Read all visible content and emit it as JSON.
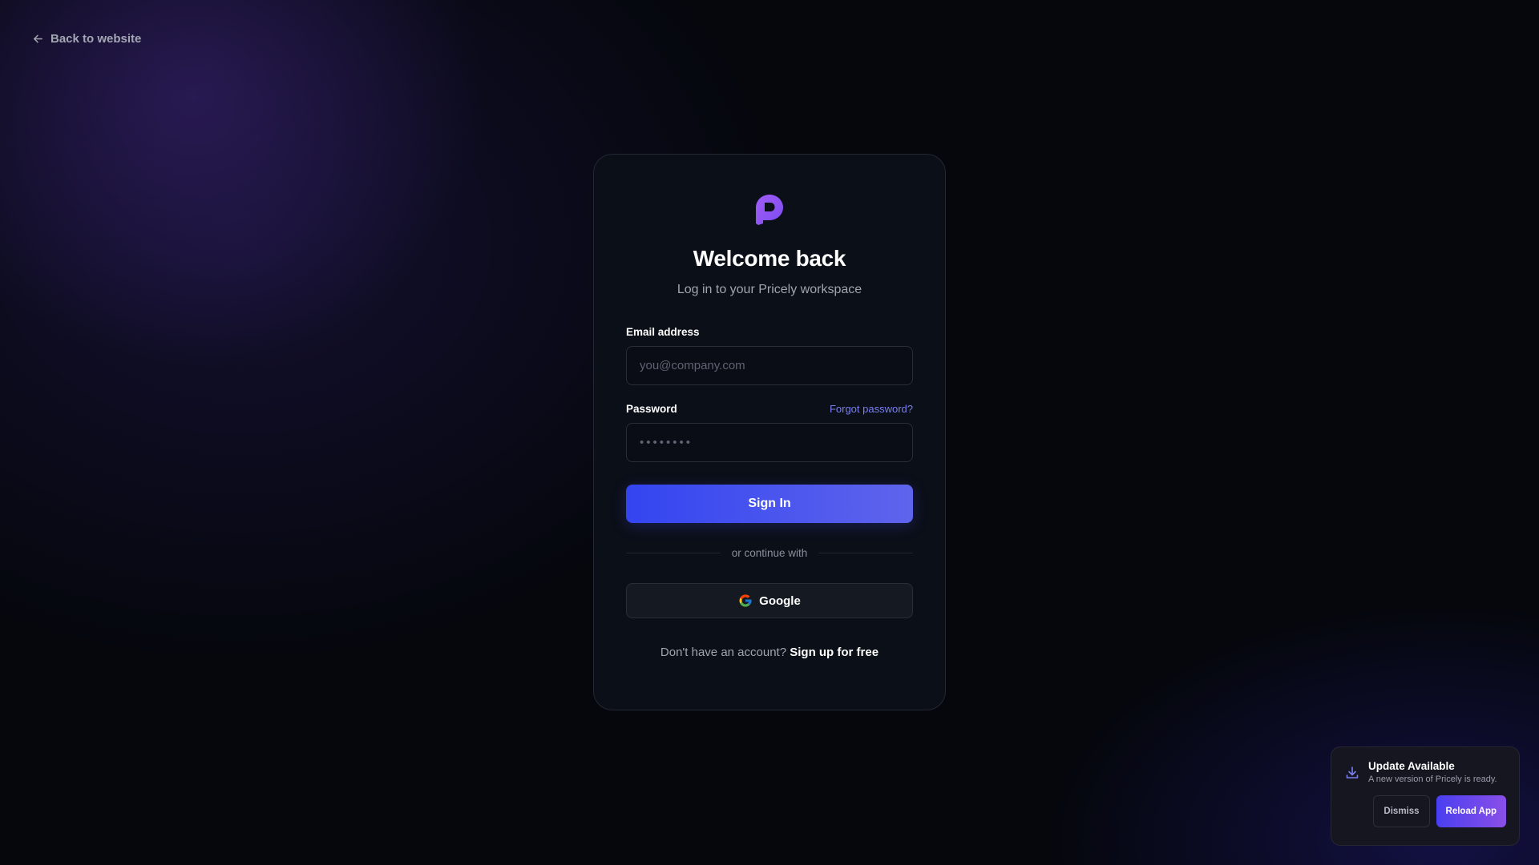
{
  "nav": {
    "back_label": "Back to website",
    "back_icon": "arrow-left-icon"
  },
  "login": {
    "logo_icon": "pricely-logo-icon",
    "title": "Welcome back",
    "subtitle": "Log in to your Pricely workspace",
    "email": {
      "label": "Email address",
      "placeholder": "you@company.com",
      "value": ""
    },
    "password": {
      "label": "Password",
      "placeholder": "••••••••",
      "value": "",
      "forgot_label": "Forgot password?"
    },
    "submit_label": "Sign In",
    "divider_text": "or continue with",
    "google_label": "Google",
    "google_icon": "google-icon",
    "signup_prompt": "Don't have an account?",
    "signup_link": "Sign up for free"
  },
  "toast": {
    "icon": "download-icon",
    "title": "Update Available",
    "description": "A new version of Pricely is ready.",
    "dismiss_label": "Dismiss",
    "reload_label": "Reload App"
  },
  "colors": {
    "background": "#05070d",
    "card": "#0b0f18",
    "primary_start": "#3345f0",
    "primary_end": "#5f64ec",
    "link": "#7b7ff0",
    "logo": "#8b5cf6",
    "reload_start": "#4a3ff0",
    "reload_end": "#8a4fe8"
  }
}
